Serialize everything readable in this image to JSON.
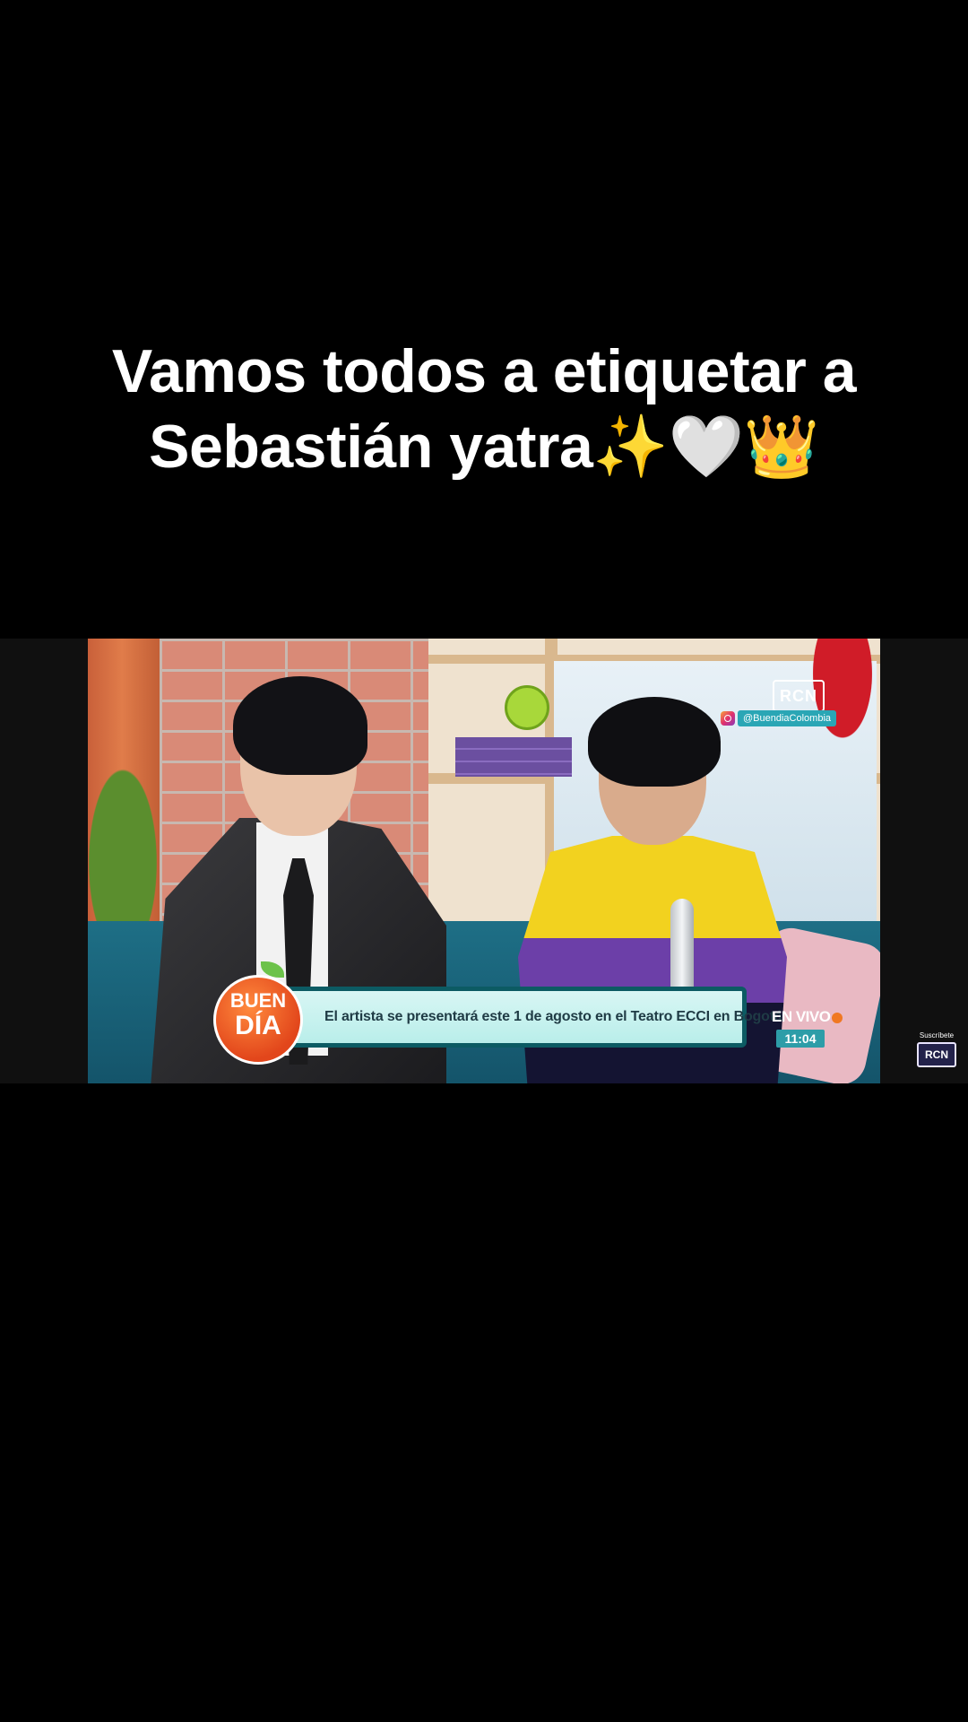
{
  "caption": {
    "line1": "Vamos todos a etiquetar a",
    "line2": "Sebastián yatra✨🤍👑"
  },
  "broadcast": {
    "channel_logo": "RCN",
    "instagram_handle": "@BuendiaColombia",
    "show_badge_line1": "BUEN",
    "show_badge_line2": "DÍA",
    "lower_third_text": "El artista se presentará este 1 de agosto en el Teatro ECCI en Bogotá",
    "live_label": "EN VIVO",
    "time": "11:04"
  },
  "subscribe": {
    "label": "Suscríbete",
    "logo": "RCN"
  },
  "colors": {
    "background": "#000000",
    "lower_third_border": "#0c5b63",
    "lower_third_fill": "#c9f2ef",
    "badge_orange": "#e2461b",
    "time_box": "#2d9da8"
  }
}
